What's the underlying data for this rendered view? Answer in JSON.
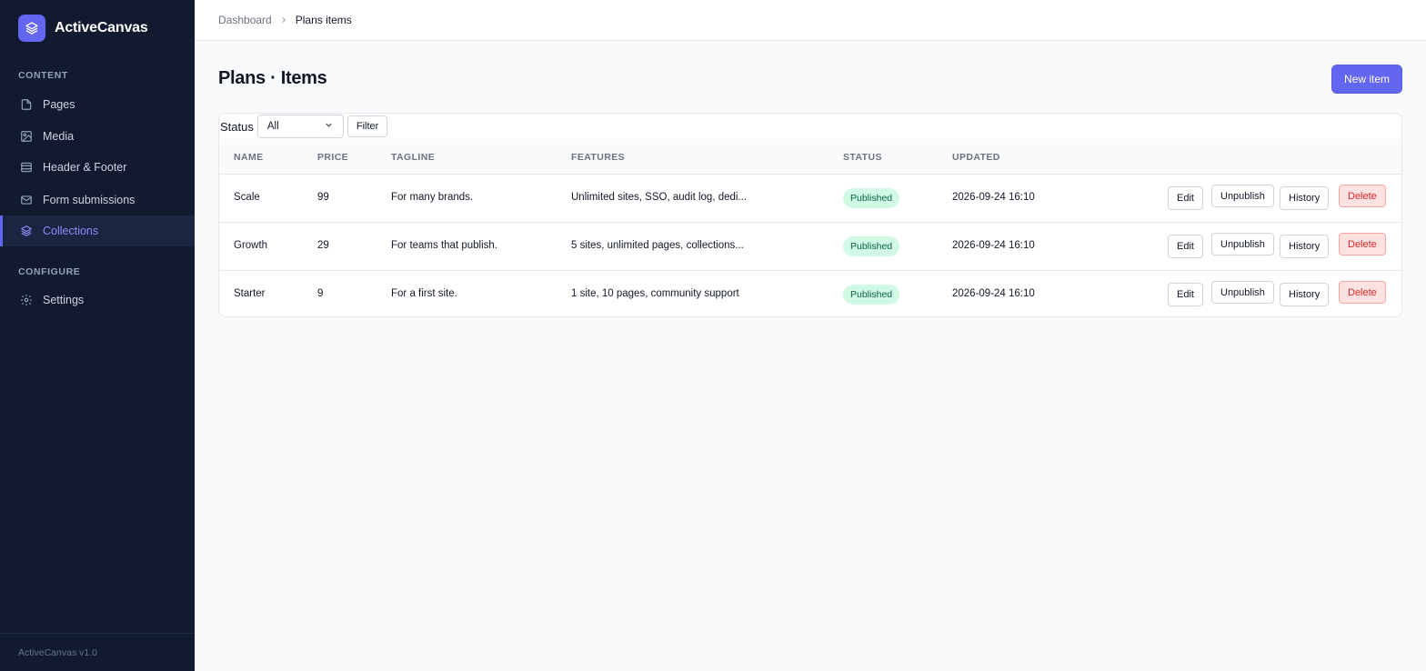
{
  "sidebar": {
    "brand": "ActiveCanvas",
    "sections": [
      {
        "title": "Content"
      },
      {
        "title": "Configure"
      }
    ],
    "items": [
      {
        "label": "Pages",
        "icon": "file-icon"
      },
      {
        "label": "Media",
        "icon": "image-icon"
      },
      {
        "label": "Header & Footer",
        "icon": "layout-icon"
      },
      {
        "label": "Form submissions",
        "icon": "mail-icon"
      },
      {
        "label": "Collections",
        "icon": "layers-icon",
        "active": true
      },
      {
        "label": "Settings",
        "icon": "gear-icon"
      }
    ],
    "footer": "ActiveCanvas v1.0"
  },
  "breadcrumb": {
    "parent": "Dashboard",
    "current": "Plans items"
  },
  "main": {
    "title": "Plans · Items",
    "new_button": "New item"
  },
  "filter": {
    "label": "Status",
    "selected": "All",
    "button": "Filter"
  },
  "table": {
    "columns": [
      "Name",
      "Price",
      "Tagline",
      "Features",
      "Status",
      "Updated"
    ],
    "rows": [
      {
        "name": "Scale",
        "price": "99",
        "tagline": "For many brands.",
        "features": "Unlimited sites, SSO, audit log, dedi...",
        "status": "Published",
        "updated": "2026-09-24 16:10"
      },
      {
        "name": "Growth",
        "price": "29",
        "tagline": "For teams that publish.",
        "features": "5 sites, unlimited pages, collections...",
        "status": "Published",
        "updated": "2026-09-24 16:10"
      },
      {
        "name": "Starter",
        "price": "9",
        "tagline": "For a first site.",
        "features": "1 site, 10 pages, community support",
        "status": "Published",
        "updated": "2026-09-24 16:10"
      }
    ],
    "actions": {
      "edit": "Edit",
      "unpublish": "Unpublish",
      "history": "History",
      "delete": "Delete"
    }
  },
  "colors": {
    "accent": "#6366f1",
    "sidebar_bg": "#111a2e",
    "published_bg": "#d1fae5",
    "danger": "#dc2626"
  }
}
